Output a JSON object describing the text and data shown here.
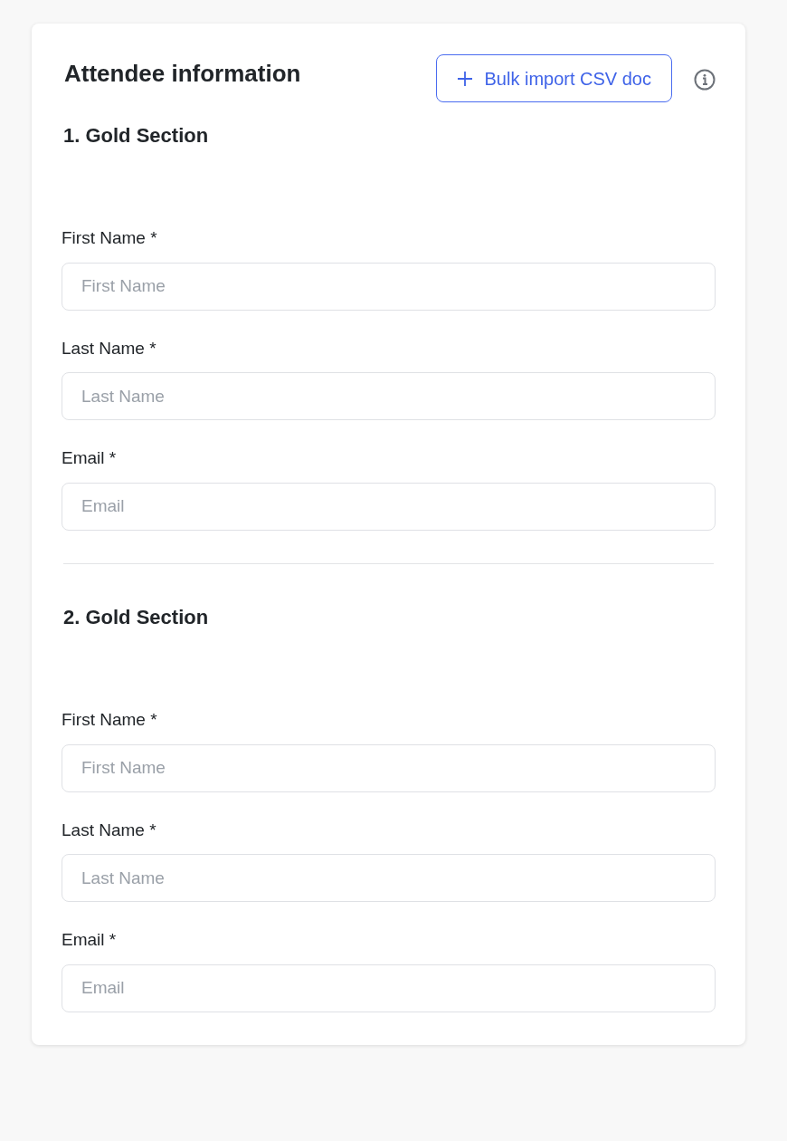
{
  "title": "Attendee information",
  "import_button": {
    "label": "Bulk import CSV doc"
  },
  "sections": [
    {
      "heading": "1. Gold Section",
      "fields": [
        {
          "label": "First Name *",
          "placeholder": "First Name"
        },
        {
          "label": "Last Name *",
          "placeholder": "Last Name"
        },
        {
          "label": "Email *",
          "placeholder": "Email"
        }
      ]
    },
    {
      "heading": "2. Gold Section",
      "fields": [
        {
          "label": "First Name *",
          "placeholder": "First Name"
        },
        {
          "label": "Last Name *",
          "placeholder": "Last Name"
        },
        {
          "label": "Email *",
          "placeholder": "Email"
        }
      ]
    }
  ]
}
